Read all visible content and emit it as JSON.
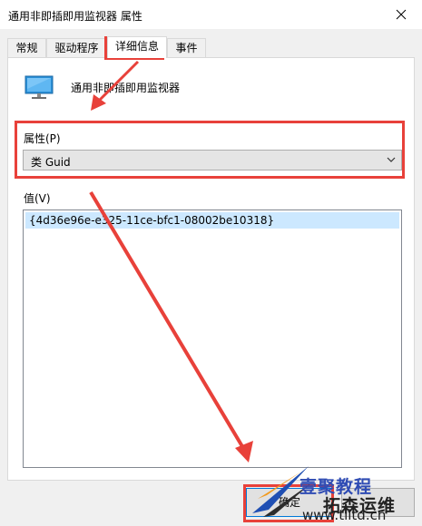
{
  "window": {
    "title": "通用非即插即用监视器 属性"
  },
  "tabs": [
    {
      "label": "常规"
    },
    {
      "label": "驱动程序"
    },
    {
      "label": "详细信息"
    },
    {
      "label": "事件"
    }
  ],
  "device": {
    "name": "通用非即插即用监视器",
    "icon": "monitor-icon"
  },
  "property": {
    "label": "属性(P)",
    "selected": "类 Guid"
  },
  "value": {
    "label": "值(V)",
    "items": [
      "{4d36e96e-e325-11ce-bfc1-08002be10318}"
    ]
  },
  "buttons": {
    "ok": "确定"
  },
  "watermark": {
    "line1": "壹聚教程",
    "line2": "拓森运维",
    "url": "www.tlltd.cn"
  },
  "colors": {
    "highlight": "#e8413a",
    "selection": "#cce8ff",
    "accent": "#0078d7"
  }
}
